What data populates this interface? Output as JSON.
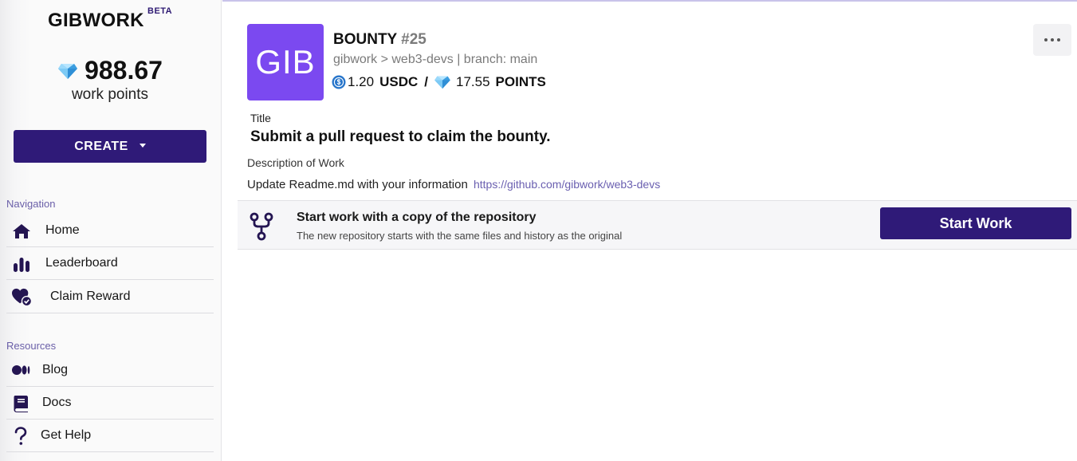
{
  "sidebar": {
    "brand": "GIBWORK",
    "beta": "BETA",
    "points_value": "988.67",
    "points_label": "work points",
    "create_label": "CREATE",
    "navigation_label": "Navigation",
    "nav_items": [
      {
        "label": "Home",
        "icon": "home-icon"
      },
      {
        "label": "Leaderboard",
        "icon": "leaderboard-icon"
      },
      {
        "label": "Claim Reward",
        "icon": "heart-check-icon"
      }
    ],
    "resources_label": "Resources",
    "resource_items": [
      {
        "label": "Blog",
        "icon": "medium-icon"
      },
      {
        "label": "Docs",
        "icon": "book-icon"
      },
      {
        "label": "Get Help",
        "icon": "question-icon"
      }
    ]
  },
  "bounty": {
    "logo_text": "GIB",
    "title_prefix": "BOUNTY",
    "number": "#25",
    "breadcrumb": "gibwork > web3-devs | branch: main",
    "usdc_amount": "1.20",
    "usdc_unit": "USDC",
    "separator": "/",
    "points_amount": "17.55",
    "points_unit": "POINTS",
    "title_label": "Title",
    "title": "Submit a pull request to claim the bounty.",
    "description_label": "Description of Work",
    "description_text": "Update Readme.md with your information",
    "description_link": "https://github.com/gibwork/web3-devs"
  },
  "repo_panel": {
    "title": "Start work with a copy of the repository",
    "subtitle": "The new repository starts with the same files and history as the original",
    "button_label": "Start Work"
  },
  "colors": {
    "brand_primary": "#2f1a78",
    "logo_bg": "#7b49f0",
    "link": "#6a5fb0",
    "usdc_blue": "#2775ca",
    "diamond_blue": "#5ab8f0"
  }
}
